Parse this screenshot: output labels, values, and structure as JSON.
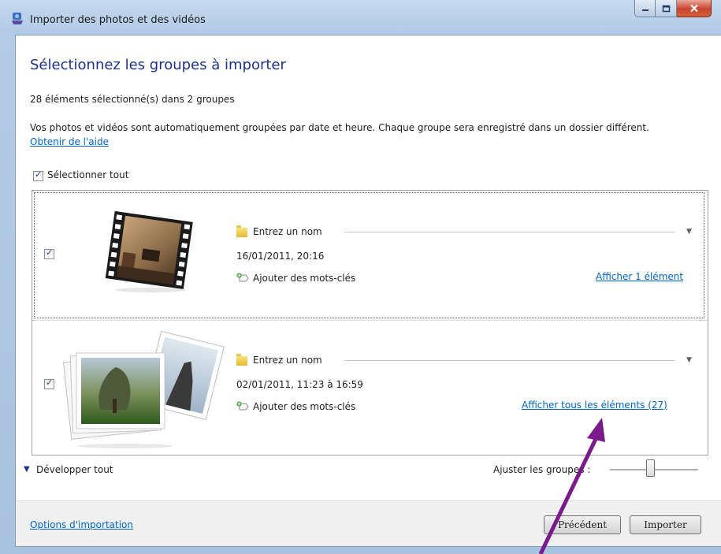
{
  "window": {
    "title": "Importer des photos et des vidéos",
    "heading": "Sélectionnez les groupes à importer",
    "selection_count": "28 éléments sélectionné(s) dans 2 groupes",
    "description": "Vos photos et vidéos sont automatiquement groupées par date et heure. Chaque groupe sera enregistré dans un dossier différent.",
    "help_link": "Obtenir de l'aide",
    "select_all": "Sélectionner tout",
    "select_all_checked": true
  },
  "groups": [
    {
      "checked": true,
      "name_placeholder": "Entrez un nom",
      "date": "16/01/2011, 20:16",
      "tags_label": "Ajouter des mots-clés",
      "show_link": "Afficher 1 élément",
      "thumbnail": "video-filmstrip-thumbnail"
    },
    {
      "checked": true,
      "name_placeholder": "Entrez un nom",
      "date": "02/01/2011, 11:23 à 16:59",
      "tags_label": "Ajouter des mots-clés",
      "show_link": "Afficher tous les éléments (27)",
      "thumbnail": "photo-stack-thumbnail"
    }
  ],
  "footer": {
    "expand_all": "Développer tout",
    "adjust_groups": "Ajuster les groupes :",
    "import_options": "Options d'importation",
    "previous_button": "Précédent",
    "import_button": "Importer"
  },
  "colors": {
    "heading": "#1e3287",
    "link": "#0066cc",
    "annotation_arrow": "#7b1a8a"
  },
  "icons": [
    "app-import-icon",
    "folder-icon",
    "add-tag-icon",
    "chevron-down-icon",
    "minimize-icon",
    "maximize-icon",
    "close-icon"
  ]
}
